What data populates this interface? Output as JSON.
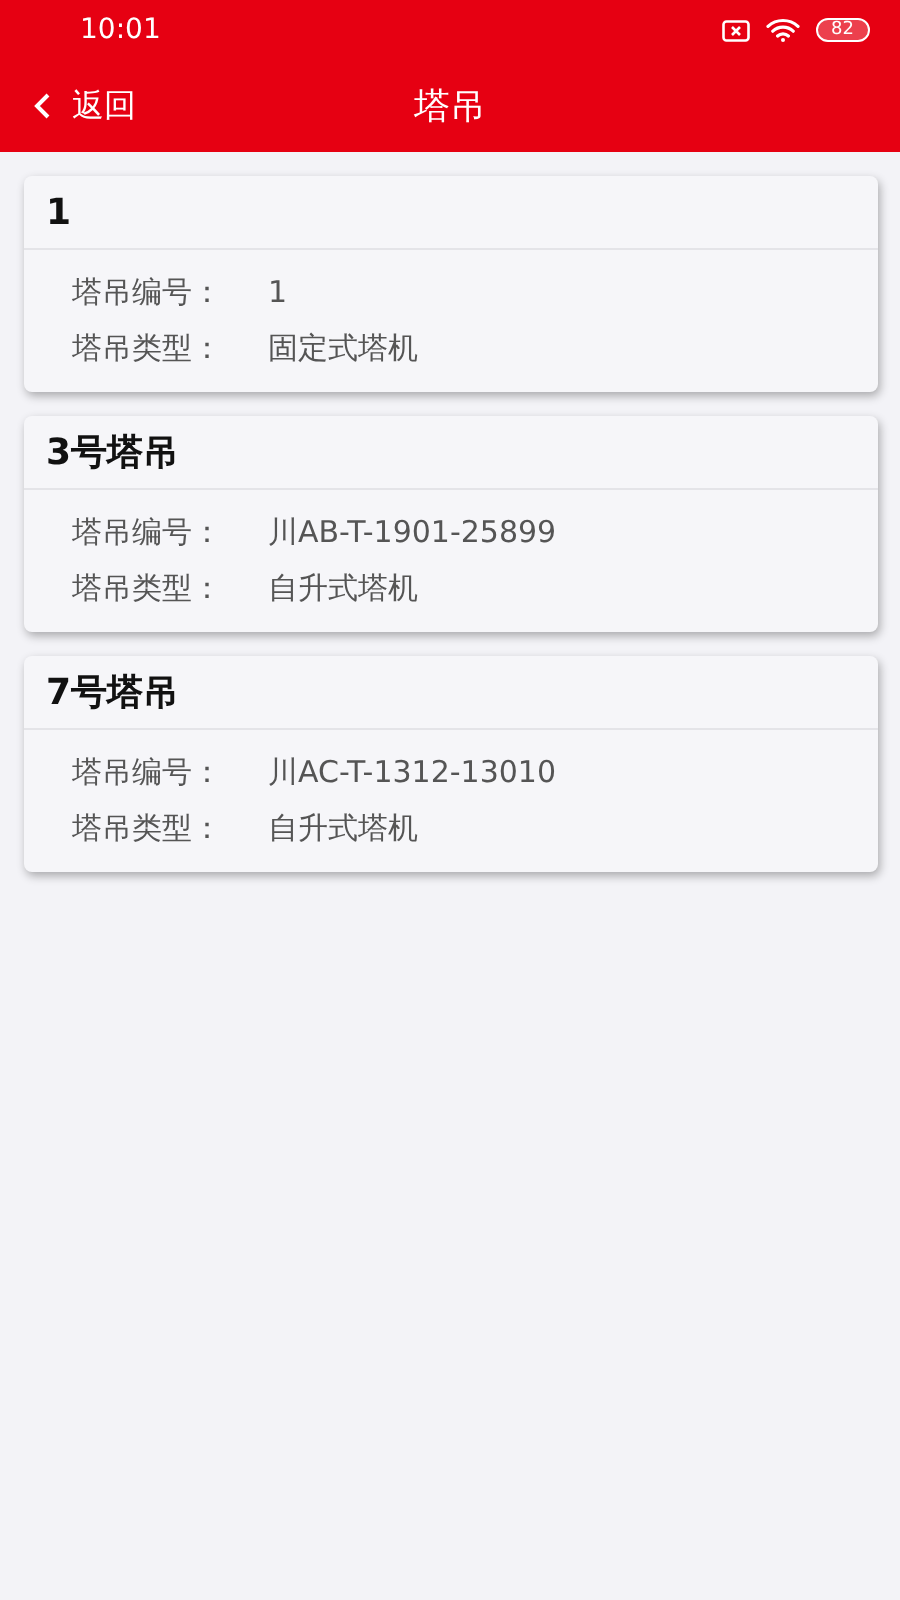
{
  "status_bar": {
    "time": "10:01",
    "battery": "82"
  },
  "nav": {
    "back": "返回",
    "title": "塔吊"
  },
  "cards": [
    {
      "title": "1",
      "fields": [
        {
          "label": "塔吊编号：",
          "value": "1"
        },
        {
          "label": "塔吊类型：",
          "value": "固定式塔机"
        }
      ]
    },
    {
      "title": "3号塔吊",
      "fields": [
        {
          "label": "塔吊编号：",
          "value": "川AB-T-1901-25899"
        },
        {
          "label": "塔吊类型：",
          "value": "自升式塔机"
        }
      ]
    },
    {
      "title": "7号塔吊",
      "fields": [
        {
          "label": "塔吊编号：",
          "value": "川AC-T-1312-13010"
        },
        {
          "label": "塔吊类型：",
          "value": "自升式塔机"
        }
      ]
    }
  ]
}
